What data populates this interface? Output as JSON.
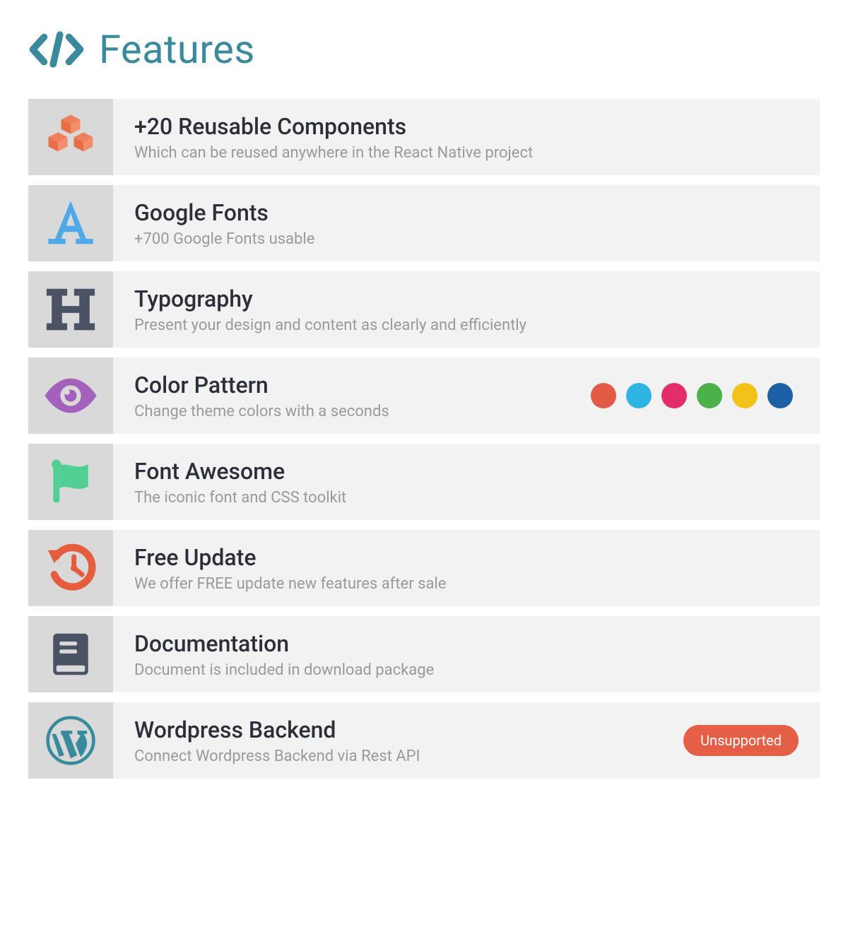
{
  "header": {
    "title": "Features",
    "icon": "code-icon",
    "icon_color": "#3a8a9e"
  },
  "features": [
    {
      "icon": "cubes-icon",
      "icon_color": "#ee805b",
      "title": "+20 Reusable Components",
      "desc": "Which can be reused anywhere in the React Native project"
    },
    {
      "icon": "font-a-icon",
      "icon_color": "#4eaae6",
      "title": "Google Fonts",
      "desc": "+700 Google Fonts usable"
    },
    {
      "icon": "heading-h-icon",
      "icon_color": "#4a5263",
      "title": "Typography",
      "desc": "Present your design and content as clearly and efficiently"
    },
    {
      "icon": "eye-icon",
      "icon_color": "#a461bc",
      "title": "Color Pattern",
      "desc": "Change theme colors with a seconds",
      "swatches": [
        "#e25a44",
        "#2fb3e2",
        "#e22d6a",
        "#4bb14b",
        "#f3c219",
        "#1c61a8"
      ]
    },
    {
      "icon": "flag-icon",
      "icon_color": "#52cf95",
      "title": "Font Awesome",
      "desc": "The iconic font and CSS toolkit"
    },
    {
      "icon": "history-icon",
      "icon_color": "#e55d3e",
      "title": "Free Update",
      "desc": "We offer FREE update new features after sale"
    },
    {
      "icon": "book-icon",
      "icon_color": "#4a5263",
      "title": "Documentation",
      "desc": "Document is included in download package"
    },
    {
      "icon": "wordpress-icon",
      "icon_color": "#3a8a9e",
      "title": "Wordpress Backend",
      "desc": "Connect Wordpress Backend via Rest API",
      "badge": "Unsupported"
    }
  ]
}
